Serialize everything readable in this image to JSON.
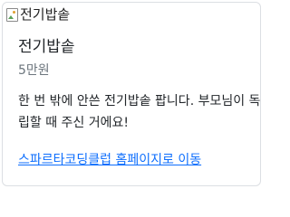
{
  "card": {
    "image_alt": "전기밥솥",
    "title": "전기밥솥",
    "price": "5만원",
    "description": "한 번 밖에 안쓴 전기밥솥 팝니다. 부모님이 독립할 때 주신 거에요!",
    "link_text": "스파르타코딩클럽 홈페이지로 이동",
    "link_color": "#0d6efd",
    "broken_image_icon": "broken-image-icon"
  }
}
